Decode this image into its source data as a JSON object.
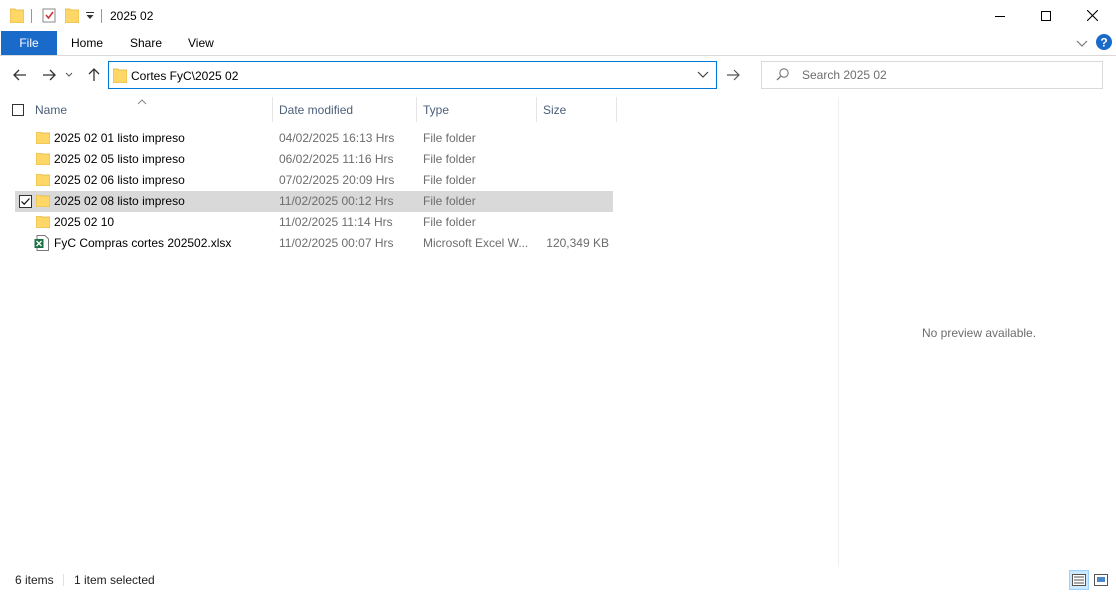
{
  "window": {
    "title": "2025 02"
  },
  "ribbon": {
    "tabs": [
      "File",
      "Home",
      "Share",
      "View"
    ],
    "help_icon": "help-icon",
    "expand_icon": "chevron-down-icon"
  },
  "address_bar": {
    "path": "Cortes FyC\\2025 02"
  },
  "search": {
    "placeholder": "Search 2025 02"
  },
  "columns": [
    "Name",
    "Date modified",
    "Type",
    "Size"
  ],
  "files": [
    {
      "name": "2025 02 01 listo impreso",
      "date": "04/02/2025 16:13 Hrs",
      "type": "File folder",
      "size": "",
      "icon": "folder-icon",
      "selected": false
    },
    {
      "name": "2025 02 05 listo impreso",
      "date": "06/02/2025 11:16 Hrs",
      "type": "File folder",
      "size": "",
      "icon": "folder-icon",
      "selected": false
    },
    {
      "name": "2025 02 06 listo impreso",
      "date": "07/02/2025 20:09 Hrs",
      "type": "File folder",
      "size": "",
      "icon": "folder-icon",
      "selected": false
    },
    {
      "name": "2025 02 08 listo impreso",
      "date": "11/02/2025 00:12 Hrs",
      "type": "File folder",
      "size": "",
      "icon": "folder-icon",
      "selected": true
    },
    {
      "name": "2025 02 10",
      "date": "11/02/2025 11:14 Hrs",
      "type": "File folder",
      "size": "",
      "icon": "folder-icon",
      "selected": false
    },
    {
      "name": "FyC Compras cortes 202502.xlsx",
      "date": "11/02/2025 00:07 Hrs",
      "type": "Microsoft Excel W...",
      "size": "120,349 KB",
      "icon": "excel-file-icon",
      "selected": false
    }
  ],
  "preview": {
    "message": "No preview available."
  },
  "status_bar": {
    "item_count": "6 items",
    "selection": "1 item selected"
  },
  "colors": {
    "accent": "#1a6ac9",
    "address_border": "#0078d7",
    "folder": "#ffd767",
    "selected_row": "#d9d9d9"
  }
}
